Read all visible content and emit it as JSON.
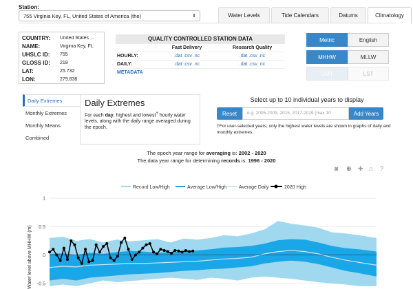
{
  "station": {
    "label": "Station:",
    "selected": "755 Virginia Key, FL, United States of America (the)"
  },
  "tabs": [
    {
      "label": "Water Levels",
      "active": false
    },
    {
      "label": "Tide Calendars",
      "active": false
    },
    {
      "label": "Datums",
      "active": false
    },
    {
      "label": "Climatology",
      "active": true
    }
  ],
  "meta": [
    {
      "key": "COUNTRY:",
      "value": "United States ..."
    },
    {
      "key": "NAME:",
      "value": "Virginia Key, FL"
    },
    {
      "key": "UHSLC ID:",
      "value": "755"
    },
    {
      "key": "GLOSS ID:",
      "value": "218"
    },
    {
      "key": "LAT:",
      "value": "25.732"
    },
    {
      "key": "LON:",
      "value": "279.838"
    }
  ],
  "qc": {
    "title": "QUALITY CONTROLLED STATION DATA",
    "col_fast": "Fast Delivery",
    "col_research": "Research Quality",
    "hourly_label": "HOURLY:",
    "daily_label": "DAILY:",
    "hourly_fast": ".dat .csv .nc",
    "hourly_research": ".dat .csv .nc",
    "daily_fast": ".dat .csv .nc",
    "daily_research": ".dat .csv .nc",
    "metadata_link": "METADATA"
  },
  "units": {
    "metric": "Metric",
    "english": "English",
    "mhhw": "MHHW",
    "mllw": "MLLW",
    "gmt": "GMT",
    "lst": "LST"
  },
  "side_menu": [
    {
      "label": "Daily Extremes",
      "active": true
    },
    {
      "label": "Monthly Extremes",
      "active": false
    },
    {
      "label": "Monthly Means",
      "active": false
    },
    {
      "label": "Combined",
      "active": false
    }
  ],
  "panel": {
    "title": "Daily Extremes",
    "text_a": "For each ",
    "text_bold": "day",
    "text_b": ", highest and lowest",
    "text_sup": "†",
    "text_c": " hourly water levels, along with the daily range averaged during the epoch."
  },
  "years": {
    "title": "Select up to 10 individual years to display",
    "reset": "Reset",
    "placeholder": "e.g. 2005-2009, 2015, 2017-2019 (max 10",
    "add": "Add Years",
    "note": "†For user-selected years, only the highest water levels are shown in graphs of daily and monthly extremes."
  },
  "epoch": {
    "line1_prefix": "The epoch year range for ",
    "line1_bold": "averaging",
    "line1_mid": " is: ",
    "line1_value": "2002 - 2020",
    "line2_prefix": "The data year range for determining ",
    "line2_bold": "records",
    "line2_mid": " is: ",
    "line2_value": "1996 - 2020"
  },
  "toolbar_icons": [
    "camera-icon",
    "zoom-icon",
    "plus-icon",
    "autoscale-icon",
    "home-icon",
    "help-icon"
  ],
  "colors": {
    "accent": "#3a87c8",
    "record_fill": "#9fd8ef",
    "average_fill": "#1aa7e8",
    "average_daily": "#cfe6f5",
    "series_2020": "#000000"
  },
  "chart_data": {
    "type": "area",
    "ylabel": "Water level above MHHW (m)",
    "y_ticks": [
      "1",
      "0.5",
      "0",
      "-0.5"
    ],
    "ylim": [
      -0.6,
      1.05
    ],
    "x": [
      0,
      15,
      30,
      45,
      60,
      75,
      90,
      105,
      120,
      135,
      150,
      165,
      180,
      195,
      210,
      225,
      240,
      255,
      270,
      285,
      300,
      315,
      330,
      345,
      365
    ],
    "series": [
      {
        "name": "Record Low/High",
        "upper": [
          0.3,
          0.32,
          0.25,
          0.28,
          0.22,
          0.27,
          0.24,
          0.26,
          0.28,
          0.22,
          0.29,
          0.27,
          0.3,
          0.35,
          0.33,
          0.38,
          0.45,
          0.6,
          0.55,
          0.52,
          0.48,
          0.4,
          0.38,
          0.35,
          0.3
        ],
        "lower": [
          -0.55,
          -0.52,
          -0.55,
          -0.5,
          -0.45,
          -0.48,
          -0.46,
          -0.44,
          -0.42,
          -0.4,
          -0.42,
          -0.44,
          -0.4,
          -0.42,
          -0.45,
          -0.4,
          -0.38,
          -0.4,
          -0.42,
          -0.45,
          -0.48,
          -0.5,
          -0.52,
          -0.55,
          -0.55
        ]
      },
      {
        "name": "Average Low/High",
        "upper": [
          0.02,
          0.03,
          0.0,
          0.04,
          0.02,
          0.05,
          0.07,
          0.06,
          0.04,
          0.05,
          0.06,
          0.08,
          0.1,
          0.13,
          0.14,
          0.16,
          0.2,
          0.26,
          0.28,
          0.27,
          0.22,
          0.16,
          0.12,
          0.1,
          0.06
        ],
        "lower": [
          -0.45,
          -0.42,
          -0.45,
          -0.4,
          -0.38,
          -0.36,
          -0.34,
          -0.33,
          -0.32,
          -0.3,
          -0.28,
          -0.27,
          -0.25,
          -0.24,
          -0.22,
          -0.2,
          -0.15,
          -0.12,
          -0.1,
          -0.12,
          -0.16,
          -0.22,
          -0.28,
          -0.32,
          -0.38
        ]
      },
      {
        "name": "Average Daily",
        "values": [
          -0.22,
          -0.2,
          -0.21,
          -0.18,
          -0.17,
          -0.16,
          -0.15,
          -0.15,
          -0.14,
          -0.13,
          -0.12,
          -0.11,
          -0.09,
          -0.07,
          -0.06,
          -0.04,
          0.02,
          0.06,
          0.08,
          0.06,
          0.02,
          -0.04,
          -0.09,
          -0.13,
          -0.18
        ]
      },
      {
        "name": "2020 High",
        "x": [
          0,
          4,
          8,
          12,
          16,
          20,
          24,
          28,
          32,
          36,
          40,
          44,
          48,
          52,
          56,
          60,
          64,
          68,
          72,
          76,
          80,
          84,
          88,
          92,
          96,
          100,
          104,
          108,
          112,
          116,
          120,
          124,
          128,
          132,
          136,
          140,
          144,
          148,
          152,
          156,
          160
        ],
        "values": [
          0.05,
          0.1,
          0.0,
          -0.1,
          0.12,
          -0.08,
          0.25,
          0.18,
          -0.05,
          -0.15,
          0.1,
          -0.12,
          -0.1,
          0.18,
          0.05,
          0.15,
          0.2,
          -0.05,
          -0.1,
          -0.02,
          0.22,
          0.3,
          0.1,
          -0.08,
          0.0,
          0.05,
          0.12,
          0.18,
          0.2,
          0.05,
          0.02,
          0.1,
          0.08,
          0.06,
          0.03,
          0.08,
          0.07,
          0.05,
          0.08,
          0.06,
          0.07
        ]
      }
    ]
  }
}
